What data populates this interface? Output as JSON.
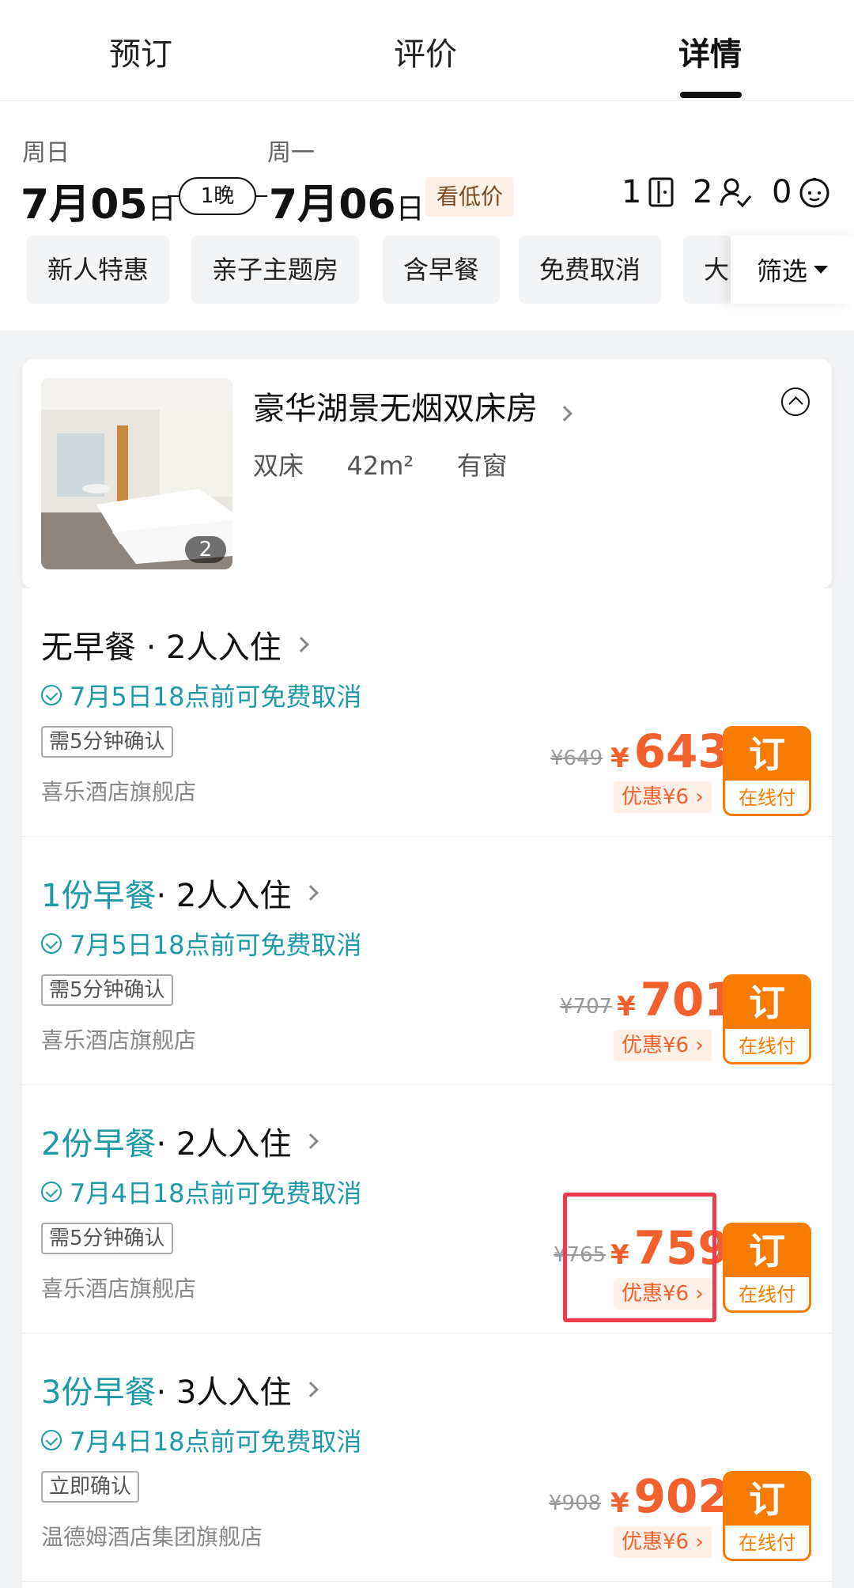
{
  "tabs": [
    "预订",
    "评价",
    "详情"
  ],
  "dates": {
    "checkin_weekday": "周日",
    "checkin_month": "7月",
    "checkin_day": "05",
    "checkin_suffix": "日",
    "nights": "1晚",
    "checkout_weekday": "周一",
    "checkout_month": "7月",
    "checkout_day": "06",
    "checkout_suffix": "日",
    "low_price_label": "看低价"
  },
  "guests": {
    "rooms": "1",
    "adults": "2",
    "children": "0"
  },
  "filters": [
    "新人特惠",
    "亲子主题房",
    "含早餐",
    "免费取消",
    "大"
  ],
  "filter_button": "筛选",
  "room": {
    "title": "豪华湖景无烟双床房",
    "bed": "双床",
    "area": "42m²",
    "window": "有窗",
    "photo_count": "2"
  },
  "rates": [
    {
      "title_highlight": "",
      "title_rest": "无早餐 · 2人入住",
      "cancel": "7月5日18点前可免费取消",
      "tag": "需5分钟确认",
      "shop": "喜乐酒店旗舰店",
      "original": "¥649",
      "yen": "¥",
      "price": "643",
      "discount": "优惠¥6 ›",
      "book": "订",
      "pay": "在线付"
    },
    {
      "title_highlight": "1份早餐",
      "title_rest": " · 2人入住",
      "cancel": "7月5日18点前可免费取消",
      "tag": "需5分钟确认",
      "shop": "喜乐酒店旗舰店",
      "original": "¥707",
      "yen": "¥",
      "price": "701",
      "discount": "优惠¥6 ›",
      "book": "订",
      "pay": "在线付"
    },
    {
      "title_highlight": "2份早餐",
      "title_rest": " · 2人入住",
      "cancel": "7月4日18点前可免费取消",
      "tag": "需5分钟确认",
      "shop": "喜乐酒店旗舰店",
      "original": "¥765",
      "yen": "¥",
      "price": "759",
      "discount": "优惠¥6 ›",
      "book": "订",
      "pay": "在线付"
    },
    {
      "title_highlight": "3份早餐",
      "title_rest": " · 3人入住",
      "cancel": "7月4日18点前可免费取消",
      "tag": "立即确认",
      "shop": "温德姆酒店集团旗舰店",
      "original": "¥908",
      "yen": "¥",
      "price": "902",
      "discount": "优惠¥6 ›",
      "book": "订",
      "pay": "在线付"
    }
  ],
  "colors": {
    "accent": "#f2602c",
    "teal": "#1d9aa6",
    "book": "#f57c00",
    "highlight": "#f03a4e"
  }
}
